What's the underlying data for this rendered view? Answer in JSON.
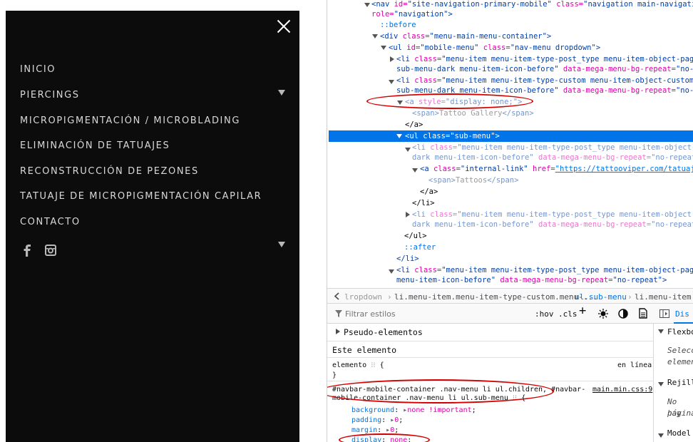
{
  "mobile_menu": {
    "items": [
      "INICIO",
      "PIERCINGS",
      "MICROPIGMENTACIÓN / MICROBLADING",
      "ELIMINACIÓN DE TATUAJES",
      "RECONSTRUCCIÓN DE PEZONES",
      "TATUAJE DE MICROPIGMENTACIÓN CAPILAR",
      "CONTACTO"
    ],
    "social_icons": [
      "facebook-icon",
      "instagram-icon"
    ],
    "colors": {
      "panel": "#0c0c0c",
      "text": "#d8d8d8"
    }
  },
  "devtools": {
    "dom": {
      "l1_tag": "<nav ",
      "l1_a1": "id=",
      "l1_v1": "\"site-navigation-primary-mobile\"",
      "l1_a2": " class=",
      "l1_v2": "\"navigation main-navigation",
      "l2_a1": "role=",
      "l2_v1": "\"navigation\"",
      "l2_end": ">",
      "l3": "::before",
      "l4_tag": "<div ",
      "l4_a1": "class=",
      "l4_v1": "\"menu-main-menu-container\"",
      "l4_end": ">",
      "l5_tag": "<ul ",
      "l5_a1": "id=",
      "l5_v1": "\"mobile-menu\"",
      "l5_a2": " class=",
      "l5_v2": "\"nav-menu dropdown\"",
      "l5_end": ">",
      "l6_tag": "<li ",
      "l6_a1": "class=",
      "l6_v1": "\"menu-item menu-item-type-post_type menu-item-object-page me",
      "l7_v1": "sub-menu-dark menu-item-icon-before\"",
      "l7_a2": " data-mega-menu-bg-repeat=",
      "l7_v2": "\"no-repea",
      "l8_tag": "<li ",
      "l8_a1": "class=",
      "l8_v1": "\"menu-item menu-item-type-custom menu-item-object-custom me",
      "l9_v1": "sub-menu-dark menu-item-icon-before\"",
      "l9_a2": " data-mega-menu-bg-repeat=",
      "l9_v2": "\"no-repea",
      "l10_tag": "<a ",
      "l10_a1": "style=",
      "l10_v1": "\"display: none;\"",
      "l10_end": ">",
      "l11_open": "<span>",
      "l11_text": "Tattoo Gallery",
      "l11_close": "</span>",
      "l12": "</a>",
      "l13_tag": "<ul ",
      "l13_a1": "class=",
      "l13_v1": "\"sub-menu\"",
      "l13_end": ">",
      "l14_tag": "<li ",
      "l14_a1": "class=",
      "l14_v1": "\"menu-item menu-item-type-post_type menu-item-object-pag",
      "l15_v1": "dark menu-item-icon-before\"",
      "l15_a2": " data-mega-menu-bg-repeat=",
      "l15_v2": "\"no-repeat\"",
      "l15_end": ">",
      "l16_tag": "<a ",
      "l16_a1": "class=",
      "l16_v1": "\"internal-link\"",
      "l16_a2": " href=",
      "l16_v2": "\"https://tattooviper.com/tatuajes/",
      "l17_open": "<span>",
      "l17_text": "Tattoos",
      "l17_close": "</span>",
      "l18": "</a>",
      "l19": "</li>",
      "l20_tag": "<li ",
      "l20_a1": "class=",
      "l20_v1": "\"menu-item menu-item-type-post_type menu-item-object-pag",
      "l21_v1": "dark menu-item-icon-before\"",
      "l21_a2": " data-mega-menu-bg-repeat=",
      "l21_v2": "\"no-repeat\"",
      "l22": "</ul>",
      "l23": "::after",
      "l24": "</li>",
      "l25_tag": "<li ",
      "l25_a1": "class=",
      "l25_v1": "\"menu-item menu-item-type-post_type menu-item-object-page me",
      "l26_v1": "menu-item-icon-before\"",
      "l26_a2": " data-mega-menu-bg-repeat=",
      "l26_v2": "\"no-repeat\"",
      "l26_end": ">"
    },
    "breadcrumb": [
      "lropdown",
      "li.menu-item.menu-item-type-custom.menu-...",
      "ul.sub-menu",
      "li.menu-item.me"
    ],
    "rules": {
      "filter_placeholder": "Filtrar estilos",
      "hov": ":hov",
      ".cls": ".cls",
      "plus": "+",
      "pseudo_elements": "Pseudo-elementos",
      "este_elemento": "Este elemento",
      "elemento": "elemento",
      "brace_open": " {",
      "en_linea": "en línea",
      "brace_close": "}",
      "selector_1": "#navbar-mobile-container .nav-menu li ul.children, #navbar-",
      "selector_2": "mobile-container .nav-menu li ul.sub-menu",
      "source": "main.min.css:9",
      "decl_1_prop": "background",
      "decl_1_val": "none !important",
      "decl_2_prop": "padding",
      "decl_2_val": "0",
      "decl_3_prop": "margin",
      "decl_3_val": "0",
      "decl_4_prop": "display",
      "decl_4_val": "none"
    },
    "layout": {
      "tab": "Dis",
      "flexbox": "Flexbo",
      "flex_desc_1": "Selecci",
      "flex_desc_2": "elemen",
      "grid": "Rejilla",
      "grid_desc_1": "No hay",
      "grid_desc_2": "página",
      "model": "Model"
    },
    "colors": {
      "selection": "#0074e8",
      "annotation": "#d40000",
      "tag": "#003eaa",
      "attr": "#dd00a9"
    }
  }
}
